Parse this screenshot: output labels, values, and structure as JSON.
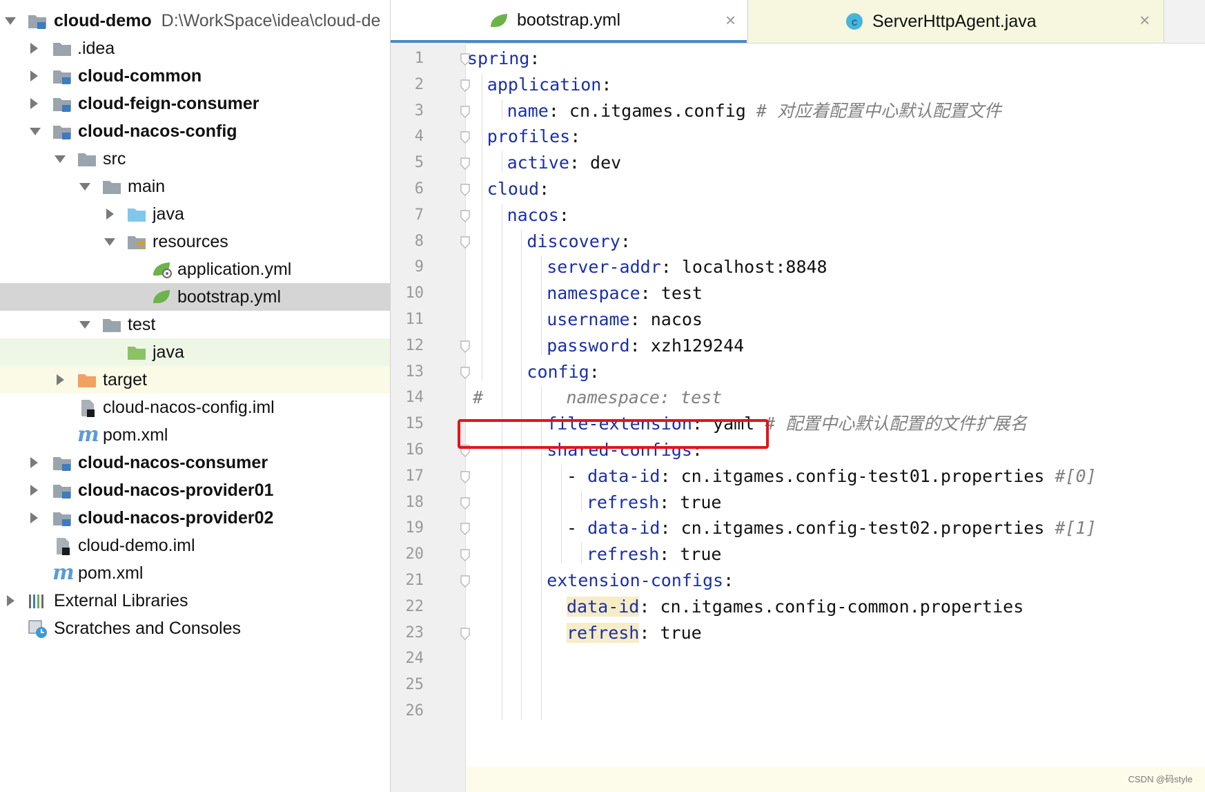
{
  "tree": {
    "root": {
      "label": "cloud-demo",
      "path": "D:\\WorkSpace\\idea\\cloud-de"
    },
    "items": [
      {
        "label": ".idea"
      },
      {
        "label": "cloud-common"
      },
      {
        "label": "cloud-feign-consumer"
      },
      {
        "label": "cloud-nacos-config"
      },
      {
        "label": "src"
      },
      {
        "label": "main"
      },
      {
        "label": "java"
      },
      {
        "label": "resources"
      },
      {
        "label": "application.yml"
      },
      {
        "label": "bootstrap.yml"
      },
      {
        "label": "test"
      },
      {
        "label": "java"
      },
      {
        "label": "target"
      },
      {
        "label": "cloud-nacos-config.iml"
      },
      {
        "label": "pom.xml"
      },
      {
        "label": "cloud-nacos-consumer"
      },
      {
        "label": "cloud-nacos-provider01"
      },
      {
        "label": "cloud-nacos-provider02"
      },
      {
        "label": "cloud-demo.iml"
      },
      {
        "label": "pom.xml"
      },
      {
        "label": "External Libraries"
      },
      {
        "label": "Scratches and Consoles"
      }
    ]
  },
  "tabs": [
    {
      "label": "bootstrap.yml",
      "active": true
    },
    {
      "label": "ServerHttpAgent.java",
      "active": false
    }
  ],
  "code": {
    "lines": [
      {
        "n": "1",
        "k": "spring",
        "p": ":",
        "v": "",
        "c": ""
      },
      {
        "n": "2",
        "k": "application",
        "p": ":",
        "v": "",
        "c": ""
      },
      {
        "n": "3",
        "k": "name",
        "p": ": ",
        "v": "cn.itgames.config ",
        "c": "# 对应着配置中心默认配置文件"
      },
      {
        "n": "4",
        "k": "profiles",
        "p": ":",
        "v": "",
        "c": ""
      },
      {
        "n": "5",
        "k": "active",
        "p": ": ",
        "v": "dev",
        "c": ""
      },
      {
        "n": "6",
        "k": "cloud",
        "p": ":",
        "v": "",
        "c": ""
      },
      {
        "n": "7",
        "k": "nacos",
        "p": ":",
        "v": "",
        "c": ""
      },
      {
        "n": "8",
        "k": "discovery",
        "p": ":",
        "v": "",
        "c": ""
      },
      {
        "n": "9",
        "k": "server-addr",
        "p": ": ",
        "v": "localhost:8848",
        "c": ""
      },
      {
        "n": "10",
        "k": "namespace",
        "p": ": ",
        "v": "test",
        "c": ""
      },
      {
        "n": "11",
        "k": "username",
        "p": ": ",
        "v": "nacos",
        "c": ""
      },
      {
        "n": "12",
        "k": "password",
        "p": ": ",
        "v": "xzh129244",
        "c": ""
      },
      {
        "n": "13",
        "k": "config",
        "p": ":",
        "v": "",
        "c": ""
      },
      {
        "n": "14",
        "k": "",
        "p": "",
        "v": "",
        "c": "#        namespace: test"
      },
      {
        "n": "15",
        "k": "file-extension",
        "p": ": ",
        "v": "yaml ",
        "c": "# 配置中心默认配置的文件扩展名"
      },
      {
        "n": "16",
        "k": "shared-configs",
        "p": ":",
        "v": "",
        "c": ""
      },
      {
        "n": "17",
        "k": "data-id",
        "p": ": ",
        "v": "cn.itgames.config-test01.properties ",
        "c": "#[0]",
        "dash": "- "
      },
      {
        "n": "18",
        "k": "refresh",
        "p": ": ",
        "v": "true",
        "c": ""
      },
      {
        "n": "19",
        "k": "data-id",
        "p": ": ",
        "v": "cn.itgames.config-test02.properties ",
        "c": "#[1]",
        "dash": "- "
      },
      {
        "n": "20",
        "k": "refresh",
        "p": ": ",
        "v": "true",
        "c": ""
      },
      {
        "n": "21",
        "k": "extension-configs",
        "p": ":",
        "v": "",
        "c": ""
      },
      {
        "n": "22",
        "k": "data-id",
        "p": ": ",
        "v": "cn.itgames.config-common.properties",
        "c": ""
      },
      {
        "n": "23",
        "k": "refresh",
        "p": ": ",
        "v": "true",
        "c": ""
      },
      {
        "n": "24",
        "k": "",
        "p": "",
        "v": "",
        "c": ""
      },
      {
        "n": "25",
        "k": "",
        "p": "",
        "v": "",
        "c": ""
      },
      {
        "n": "26",
        "k": "",
        "p": "",
        "v": "",
        "c": ""
      }
    ]
  },
  "watermark": "CSDN @码style",
  "colors": {
    "yaml_key": "#1a2fa8",
    "comment": "#808080",
    "highlight_box": "#e3141b",
    "active_tab_underline": "#4a88c7",
    "selected_row": "#d5d5d5"
  },
  "icons": [
    "folder-icon",
    "module-icon",
    "source-folder-icon",
    "test-folder-icon",
    "excluded-folder-icon",
    "resources-folder-icon",
    "spring-yml-icon",
    "iml-file-icon",
    "maven-pom-icon",
    "libraries-icon",
    "scratches-icon",
    "java-class-icon",
    "close-icon",
    "expand-arrow-icon",
    "collapse-arrow-icon"
  ]
}
